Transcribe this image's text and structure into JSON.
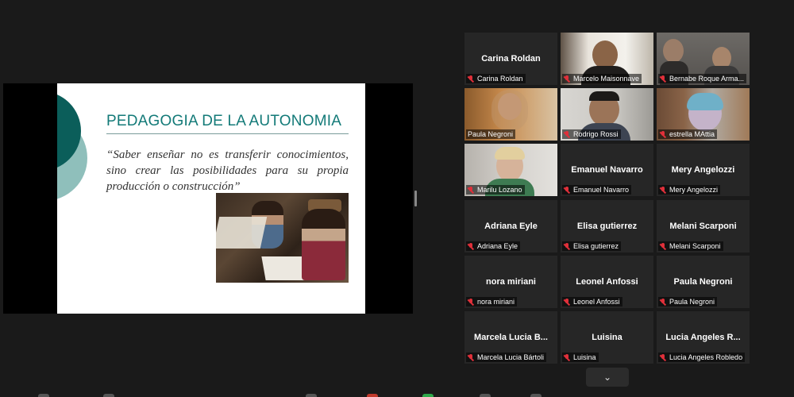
{
  "slide": {
    "title": "PEDAGOGIA DE LA AUTONOMIA",
    "quote": "“Saber enseñar no es transferir conocimientos, sino crear las posibilidades para su propia producción o construcción”"
  },
  "gallery": {
    "tiles": [
      {
        "name": "Carina Roldan",
        "label": "Carina Roldan"
      },
      {
        "label": "Marcelo Maisonnave"
      },
      {
        "label": "Bernabe Roque Arma..."
      },
      {
        "label": "Paula Negroni"
      },
      {
        "label": "Rodrigo Rossi"
      },
      {
        "label": "estrella MAttia"
      },
      {
        "label": "Marilu Lozano"
      },
      {
        "name": "Emanuel Navarro",
        "label": "Emanuel Navarro"
      },
      {
        "name": "Mery Angelozzi",
        "label": "Mery Angelozzi"
      },
      {
        "name": "Adriana Eyle",
        "label": "Adriana Eyle"
      },
      {
        "name": "Elisa gutierrez",
        "label": "Elisa gutierrez"
      },
      {
        "name": "Melani Scarponi",
        "label": "Melani Scarponi"
      },
      {
        "name": "nora miriani",
        "label": "nora miriani"
      },
      {
        "name": "Leonel Anfossi",
        "label": "Leonel Anfossi"
      },
      {
        "name": "Paula Negroni",
        "label": "Paula Negroni"
      },
      {
        "name": "Marcela Lucia B...",
        "label": "Marcela Lucia Bártoli"
      },
      {
        "name": "Luisina",
        "label": "Luisina"
      },
      {
        "name": "Lucia Angeles R...",
        "label": "Lucia Angeles Robledo"
      }
    ],
    "scroll_down_icon": "chevron-down-icon"
  },
  "colors": {
    "active_speaker": "#b9e03c",
    "muted_icon": "#e0303a",
    "slide_title": "#137a78"
  }
}
